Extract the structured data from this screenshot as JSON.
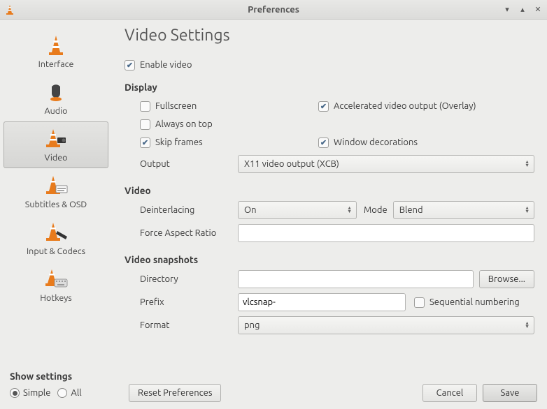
{
  "window": {
    "title": "Preferences"
  },
  "sidebar": {
    "items": [
      {
        "label": "Interface"
      },
      {
        "label": "Audio"
      },
      {
        "label": "Video"
      },
      {
        "label": "Subtitles & OSD"
      },
      {
        "label": "Input & Codecs"
      },
      {
        "label": "Hotkeys"
      }
    ],
    "selected_index": 2
  },
  "page": {
    "title": "Video Settings",
    "enable_video": {
      "label": "Enable video",
      "checked": true
    },
    "display": {
      "heading": "Display",
      "fullscreen": {
        "label": "Fullscreen",
        "checked": false
      },
      "accelerated": {
        "label": "Accelerated video output (Overlay)",
        "checked": true
      },
      "always_on_top": {
        "label": "Always on top",
        "checked": false
      },
      "skip_frames": {
        "label": "Skip frames",
        "checked": true
      },
      "window_decorations": {
        "label": "Window decorations",
        "checked": true
      },
      "output_label": "Output",
      "output_value": "X11 video output (XCB)"
    },
    "video": {
      "heading": "Video",
      "deinterlacing_label": "Deinterlacing",
      "deinterlacing_value": "On",
      "mode_label": "Mode",
      "mode_value": "Blend",
      "force_ar_label": "Force Aspect Ratio",
      "force_ar_value": ""
    },
    "snapshots": {
      "heading": "Video snapshots",
      "directory_label": "Directory",
      "directory_value": "",
      "browse_label": "Browse...",
      "prefix_label": "Prefix",
      "prefix_value": "vlcsnap-",
      "sequential_label": "Sequential numbering",
      "sequential_checked": false,
      "format_label": "Format",
      "format_value": "png"
    }
  },
  "footer": {
    "show_settings_label": "Show settings",
    "simple_label": "Simple",
    "all_label": "All",
    "mode": "simple",
    "reset_label": "Reset Preferences",
    "cancel_label": "Cancel",
    "save_label": "Save"
  }
}
